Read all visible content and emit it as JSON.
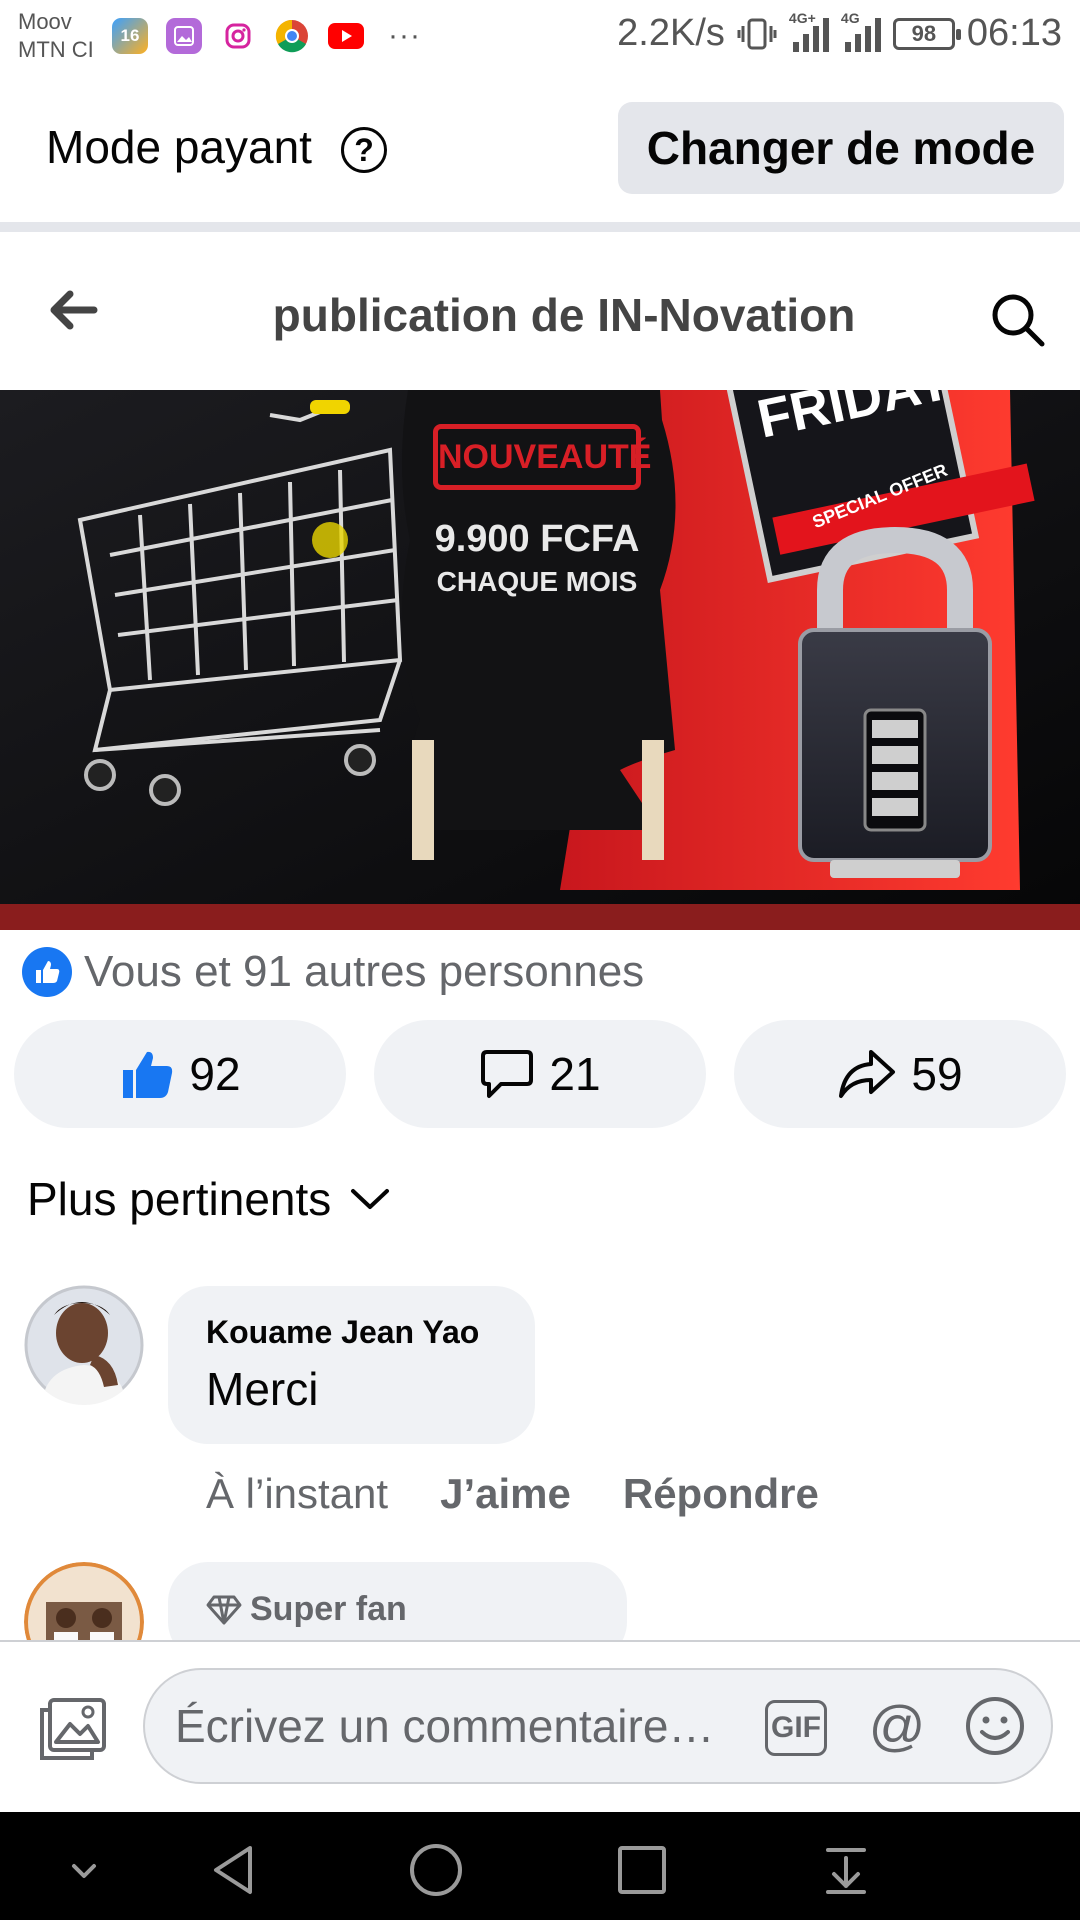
{
  "status_bar": {
    "carrier_1": "Moov",
    "carrier_2": "MTN CI",
    "notification_icons": [
      "calendar-16-icon",
      "gallery-icon",
      "instagram-icon",
      "chrome-icon",
      "youtube-icon"
    ],
    "calendar_day": "16",
    "more": "···",
    "net_speed": "2.2K/s",
    "network_1": "4G+",
    "network_2": "4G",
    "battery": "98",
    "time": "06:13"
  },
  "mode_bar": {
    "label": "Mode payant",
    "help": "?",
    "change_button": "Changer de mode"
  },
  "header": {
    "title": "publication de IN-Novation"
  },
  "post_image": {
    "badge": "NOUVEAUTÉ",
    "price": "9.900 FCFA",
    "period": "CHAQUE MOIS",
    "black_friday": "FRIDAY",
    "special_offer": "SPECIAL OFFER"
  },
  "reactions": {
    "summary": "Vous et 91 autres personnes",
    "likes": "92",
    "comments": "21",
    "shares": "59"
  },
  "sort": {
    "label": "Plus pertinents"
  },
  "comments": [
    {
      "author": "Kouame Jean Yao",
      "text": "Merci",
      "time": "À l’instant",
      "like_label": "J’aime",
      "reply_label": "Répondre"
    },
    {
      "badge": "Super fan"
    }
  ],
  "composer": {
    "placeholder": "Écrivez un commentaire…",
    "gif": "GIF",
    "mention": "@"
  },
  "colors": {
    "facebook_blue": "#1877f2",
    "pill_bg": "#f0f2f5",
    "secondary_text": "#65676b",
    "image_red": "#d81f26"
  }
}
